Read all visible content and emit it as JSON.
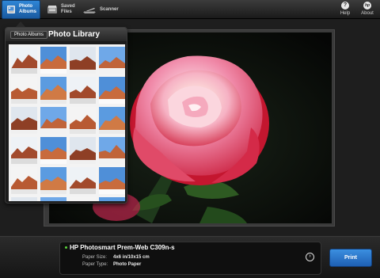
{
  "toolbar": {
    "photo_albums_label": "Photo\nAlbums",
    "saved_files_label": "Saved\nFiles",
    "scanner_label": "Scanner",
    "help_label": "Help",
    "about_label": "About",
    "help_icon_glyph": "?",
    "about_icon_glyph": "hp",
    "icons": [
      "photo-albums-icon",
      "saved-files-icon",
      "scanner-icon",
      "help-icon",
      "hp-logo-icon"
    ]
  },
  "popover": {
    "back_button_label": "Photo Albums",
    "title": "Photo Library",
    "thumbnail_count": 24
  },
  "printer": {
    "name": "HP Photosmart Prem-Web C309n-s",
    "status_color": "#5ad43b",
    "paper_size_label": "Paper Size:",
    "paper_size_value": "4x6 in/10x15 cm",
    "paper_type_label": "Paper Type:",
    "paper_type_value": "Photo Paper"
  },
  "actions": {
    "print_label": "Print",
    "details_glyph": "›"
  },
  "colors": {
    "accent": "#1e6cc4",
    "toolbar_bg": "#2a2a2a"
  }
}
